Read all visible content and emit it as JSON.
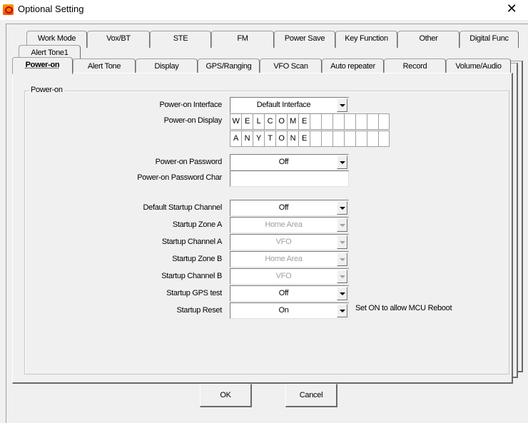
{
  "window": {
    "title": "Optional Setting",
    "close": "✕"
  },
  "tabs_row1": [
    "Work Mode",
    "Vox/BT",
    "STE",
    "FM",
    "Power Save",
    "Key Function",
    "Other",
    "Digital Func"
  ],
  "tabs_row2": [
    "Alert Tone1"
  ],
  "tabs_row3": [
    "Power-on",
    "Alert Tone",
    "Display",
    "GPS/Ranging",
    "VFO Scan",
    "Auto repeater",
    "Record",
    "Volume/Audio"
  ],
  "active_tab": "Power-on",
  "group": {
    "label": "Power-on"
  },
  "fields": {
    "interface": {
      "label": "Power-on Interface",
      "value": "Default Interface"
    },
    "display": {
      "label": "Power-on Display",
      "line1": [
        "W",
        "E",
        "L",
        "C",
        "O",
        "M",
        "E",
        "",
        "",
        "",
        "",
        "",
        "",
        ""
      ],
      "line2": [
        "A",
        "N",
        "Y",
        "T",
        "O",
        "N",
        "E",
        "",
        "",
        "",
        "",
        "",
        "",
        ""
      ]
    },
    "password": {
      "label": "Power-on Password",
      "value": "Off"
    },
    "password_char": {
      "label": "Power-on Password Char",
      "value": ""
    },
    "default_channel": {
      "label": "Default Startup Channel",
      "value": "Off"
    },
    "zone_a": {
      "label": "Startup Zone A",
      "value": "Home Area"
    },
    "channel_a": {
      "label": "Startup Channel A",
      "value": "VFO"
    },
    "zone_b": {
      "label": "Startup Zone B",
      "value": "Home Area"
    },
    "channel_b": {
      "label": "Startup Channel B",
      "value": "VFO"
    },
    "gps_test": {
      "label": "Startup GPS test",
      "value": "Off"
    },
    "reset": {
      "label": "Startup Reset",
      "value": "On",
      "note": "Set ON to allow MCU Reboot"
    }
  },
  "buttons": {
    "ok": "OK",
    "cancel": "Cancel"
  }
}
